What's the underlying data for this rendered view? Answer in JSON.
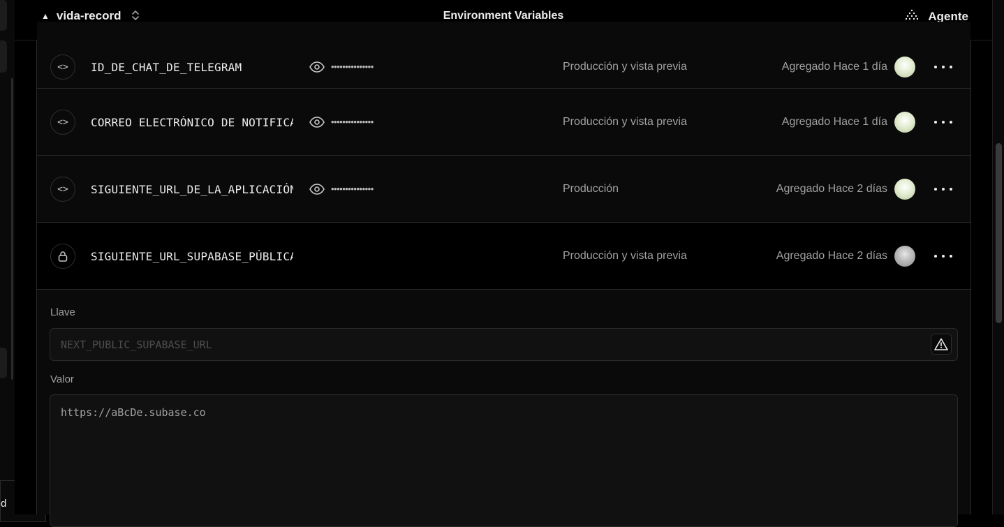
{
  "header": {
    "project": "vida-record",
    "title": "Environment Variables",
    "agent_label": "Agente"
  },
  "rail": {
    "bottom_label": "d"
  },
  "variables": [
    {
      "icon": "code-icon",
      "key": "ID_DE_CHAT_DE_TELEGRAM",
      "masked": "•••••••••••••••",
      "environment": "Producción y vista previa",
      "added": "Agregado Hace 1 día"
    },
    {
      "icon": "code-icon",
      "key": "CORREO ELECTRÓNICO DE NOTIFICACIÓN",
      "masked": "•••••••••••••••",
      "environment": "Producción y vista previa",
      "added": "Agregado Hace 1 día"
    },
    {
      "icon": "code-icon",
      "key": "SIGUIENTE_URL_DE_LA_APLICACIÓN",
      "masked": "•••••••••••••••",
      "environment": "Producción",
      "added": "Agregado Hace 2 días"
    },
    {
      "icon": "lock-icon",
      "key": "SIGUIENTE_URL_SUPABASE_PÚBLICA",
      "masked": "",
      "environment": "Producción y vista previa",
      "added": "Agregado Hace 2 días"
    }
  ],
  "editor": {
    "key_label": "Llave",
    "key_placeholder": "NEXT_PUBLIC_SUPABASE_URL",
    "value_label": "Valor",
    "value": "https://aBcDe.subase.co"
  },
  "colors": {
    "background": "#000000",
    "row_background": "#0a0a0a",
    "border": "#2a2a2a",
    "muted_text": "#a1a1a1"
  }
}
